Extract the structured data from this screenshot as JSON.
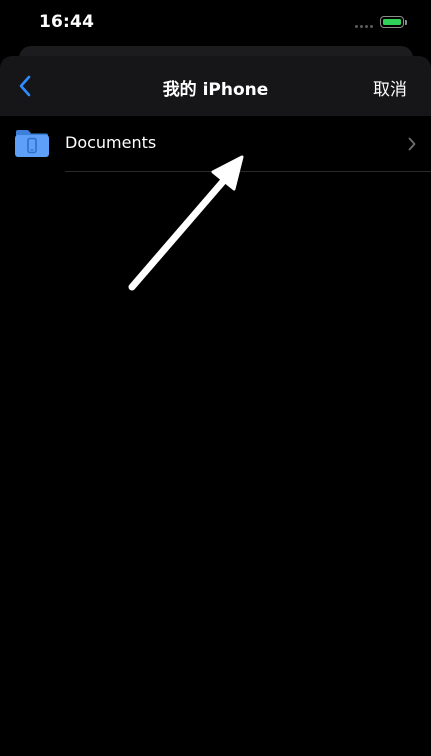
{
  "status_bar": {
    "time": "16:44",
    "battery_level": 1.0,
    "battery_color": "#30d158"
  },
  "nav": {
    "back_icon": "chevron-left-icon",
    "title": "我的 iPhone",
    "cancel_label": "取消",
    "accent_color": "#2f8cff"
  },
  "list": {
    "items": [
      {
        "label": "Documents",
        "icon": "folder-phone-icon",
        "has_disclosure": true
      }
    ]
  },
  "annotation": {
    "icon": "arrow-up-right-icon",
    "color": "#ffffff"
  }
}
